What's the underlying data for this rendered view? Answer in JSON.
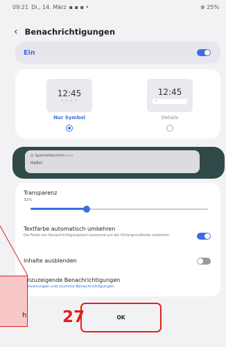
{
  "statusbar": {
    "time": "09:21",
    "date": "Di., 14. März",
    "right": "⊗ 25%"
  },
  "header": {
    "title": "Benachrichtigungen"
  },
  "ein": {
    "label": "Ein",
    "on": true
  },
  "styles": {
    "option1": {
      "time": "12:45",
      "dots": "• • • •",
      "label": "Nur Symbol",
      "selected": true
    },
    "option2": {
      "time": "12:45",
      "label": "Details",
      "selected": false
    }
  },
  "lockscreen": {
    "title": "◎ Sperrbildschirm",
    "meta": "jetzt",
    "body": "Hallo!"
  },
  "transparency": {
    "label": "Transparenz",
    "value_text": "32%",
    "value": 32
  },
  "textcolor": {
    "title": "Textfarbe automatisch umkehren",
    "desc": "Die Farbe von Benachrichtigungstext basierend auf der Hintergrundfarbe umkehren.",
    "on": true
  },
  "hide_content": {
    "title": "Inhalte ausblenden",
    "on": false
  },
  "shown_notifications": {
    "title": "Anzuzeigende Benachrichtigungen",
    "link": "Erinnerungen und stumme Benachrichtigungen"
  },
  "annotation": {
    "number": "27",
    "partial_letter": "h",
    "ok_label": "OK"
  },
  "colors": {
    "accent": "#3a6fe0",
    "annotation_red": "#e01f1f"
  }
}
